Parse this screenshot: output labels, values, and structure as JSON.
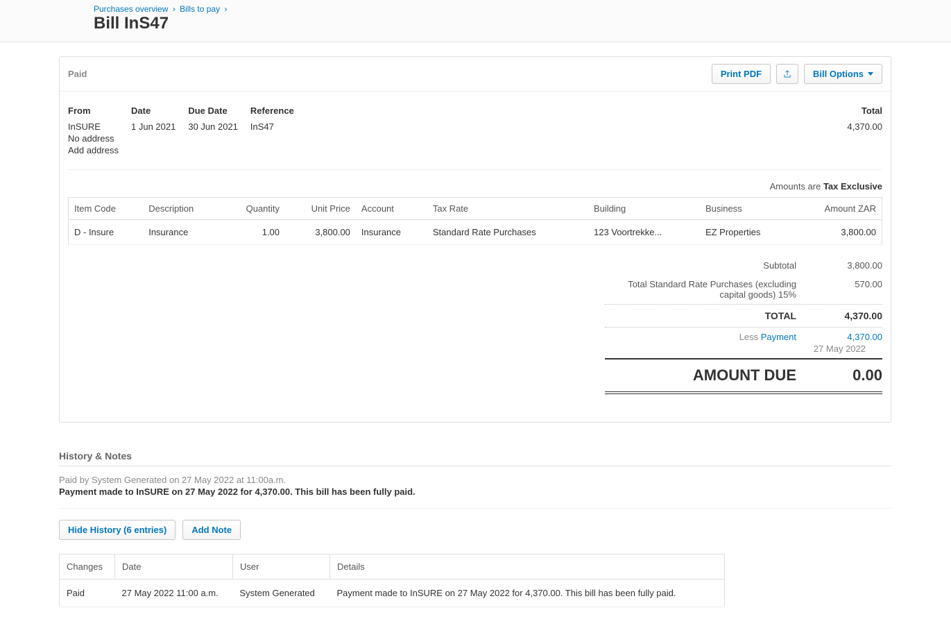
{
  "breadcrumb": {
    "items": [
      {
        "label": "Purchases overview"
      },
      {
        "label": "Bills to pay"
      }
    ],
    "sep": "›"
  },
  "page_title": "Bill InS47",
  "status": "Paid",
  "actions": {
    "print_pdf": "Print PDF",
    "bill_options": "Bill Options"
  },
  "meta": {
    "from_label": "From",
    "from_name": "InSURE",
    "from_address_none": "No address",
    "add_address": "Add address",
    "date_label": "Date",
    "date_value": "1 Jun 2021",
    "due_label": "Due Date",
    "due_value": "30 Jun 2021",
    "ref_label": "Reference",
    "ref_value": "InS47",
    "total_label": "Total",
    "total_value": "4,370.00"
  },
  "tax_note_prefix": "Amounts are ",
  "tax_note_bold": "Tax Exclusive",
  "items_table": {
    "headers": {
      "item_code": "Item Code",
      "description": "Description",
      "quantity": "Quantity",
      "unit_price": "Unit Price",
      "account": "Account",
      "tax_rate": "Tax Rate",
      "building": "Building",
      "business": "Business",
      "amount": "Amount ZAR"
    },
    "rows": [
      {
        "item_code": "D - Insure",
        "description": "Insurance",
        "quantity": "1.00",
        "unit_price": "3,800.00",
        "account": "Insurance",
        "tax_rate": "Standard Rate Purchases",
        "building": "123 Voortrekke...",
        "business": "EZ Properties",
        "amount": "3,800.00"
      }
    ]
  },
  "totals": {
    "subtotal_label": "Subtotal",
    "subtotal_value": "3,800.00",
    "tax_label": "Total Standard Rate Purchases (excluding capital goods) 15%",
    "tax_value": "570.00",
    "total_label": "TOTAL",
    "total_value": "4,370.00",
    "less_prefix": "Less ",
    "less_link": "Payment",
    "less_date": "27 May 2022",
    "less_value": "4,370.00",
    "amount_due_label": "AMOUNT DUE",
    "amount_due_value": "0.00"
  },
  "history": {
    "title": "History & Notes",
    "line1": "Paid by System Generated on 27 May 2022 at 11:00a.m.",
    "line2": "Payment made to InSURE on 27 May 2022 for 4,370.00. This bill has been fully paid.",
    "hide_button": "Hide History (6 entries)",
    "add_note": "Add Note",
    "headers": {
      "changes": "Changes",
      "date": "Date",
      "user": "User",
      "details": "Details"
    },
    "rows": [
      {
        "changes": "Paid",
        "date": "27 May 2022 11:00 a.m.",
        "user": "System Generated",
        "details": "Payment made to InSURE on 27 May 2022 for 4,370.00. This bill has been fully paid."
      }
    ]
  }
}
